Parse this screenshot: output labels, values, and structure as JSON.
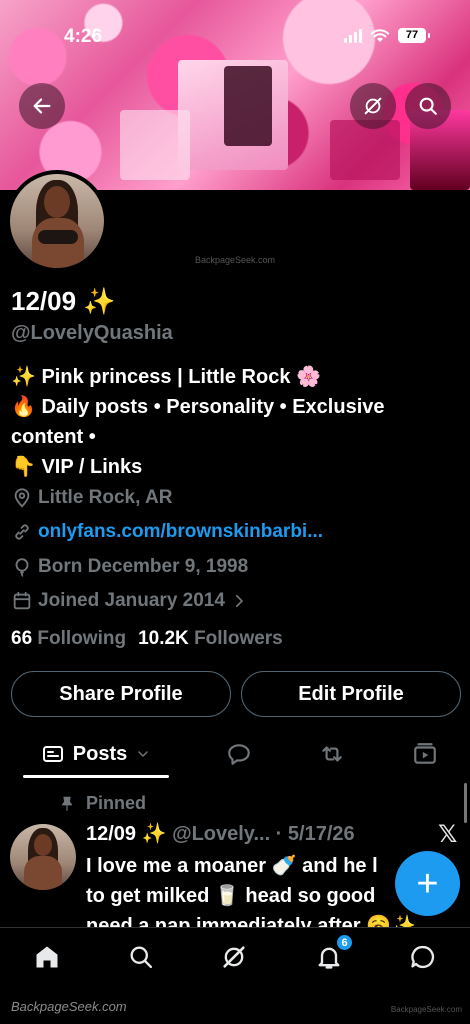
{
  "status_bar": {
    "time": "4:26",
    "battery": "77"
  },
  "profile": {
    "display_name": "12/09 ✨",
    "handle": "@LovelyQuashia",
    "bio_lines": [
      "✨ Pink princess | Little Rock 🌸",
      "🔥 Daily posts • Personality • Exclusive",
      "content •",
      "👇 VIP / Links"
    ],
    "location": "Little Rock, AR",
    "link": "onlyfans.com/brownskinbarbi...",
    "born": "Born December 9, 1998",
    "joined": "Joined January 2014",
    "following_count": "66",
    "following_label": "Following",
    "followers_count": "10.2K",
    "followers_label": "Followers"
  },
  "actions": {
    "share_label": "Share Profile",
    "edit_label": "Edit Profile"
  },
  "tabs": {
    "posts_label": "Posts"
  },
  "post": {
    "pinned_label": "Pinned",
    "name": "12/09 ✨",
    "meta": " @Lovely... · 5/17/26",
    "x_logo": "𝕏",
    "lines": [
      "I love me a moaner 🍼 and he l",
      "to get milked 🥛 head so good",
      "need a nap immediately after 🥱✨"
    ]
  },
  "fab": {
    "label": "+"
  },
  "bottom_nav": {
    "notifications_badge": "6"
  },
  "watermarks": {
    "center": "BackpageSeek.com",
    "bottom_left": "BackpageSeek.com",
    "bottom_right": "BackpageSeek.com"
  },
  "colors": {
    "accent": "#1d9bf0",
    "muted": "#71767b",
    "background": "#000000"
  },
  "icons": [
    "back-arrow-icon",
    "grok-icon",
    "search-icon",
    "location-icon",
    "link-icon",
    "balloon-icon",
    "calendar-icon",
    "chevron-right-icon",
    "chevron-down-icon",
    "reply-icon",
    "repost-icon",
    "media-icon",
    "pin-icon",
    "home-icon",
    "bell-icon",
    "message-icon"
  ]
}
